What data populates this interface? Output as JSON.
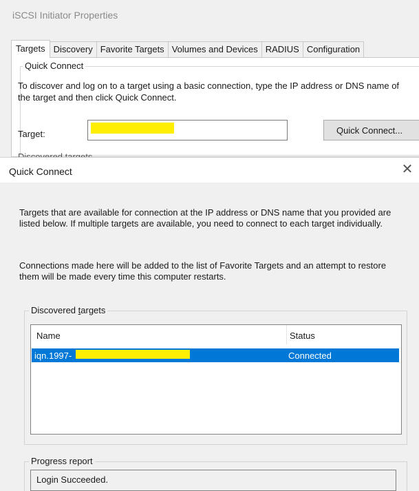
{
  "background_window": {
    "title": "iSCSI Initiator Properties",
    "tabs": [
      "Targets",
      "Discovery",
      "Favorite Targets",
      "Volumes and Devices",
      "RADIUS",
      "Configuration"
    ],
    "active_tab": "Targets",
    "quick_connect_group": {
      "legend": "Quick Connect",
      "description": "To discover and log on to a target using a basic connection, type the IP address or DNS name of the target and then click Quick Connect.",
      "target_label": "Target:",
      "target_value_redacted": true,
      "quick_connect_button": "Quick Connect...",
      "next_section_partial": "Discovered targets"
    }
  },
  "dialog": {
    "title": "Quick Connect",
    "close_icon": "close-icon",
    "intro_text": "Targets that are available for connection at the IP address or DNS name that you provided are listed below.  If multiple targets are available, you need to connect to each target individually.",
    "favorites_text": "Connections made here will be added to the list of Favorite Targets and an attempt to restore them will be made every time this computer restarts.",
    "discovered_targets": {
      "legend_prefix": "Discovered ",
      "legend_accel": "t",
      "legend_suffix": "argets",
      "columns": [
        "Name",
        "Status"
      ],
      "rows": [
        {
          "name": "iqn.1997-",
          "status": "Connected",
          "selected": true,
          "name_partially_redacted": true
        }
      ]
    },
    "progress_report": {
      "legend": "Progress report",
      "message": "Login Succeeded."
    }
  },
  "colors": {
    "selection": "#0078d7",
    "redaction": "#ffee00",
    "window_bg": "#f0f0f0"
  }
}
